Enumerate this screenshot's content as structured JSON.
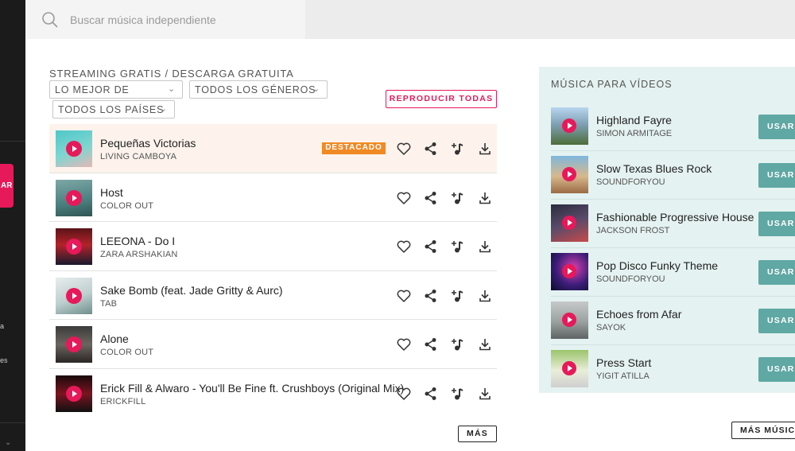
{
  "search": {
    "placeholder": "Buscar música independiente"
  },
  "sidebar": {
    "cta_fragment": "AR",
    "frag1": "a",
    "frag2": "es"
  },
  "main": {
    "heading": "STREAMING GRATIS / DESCARGA GRATUITA",
    "filters": {
      "sort": "LO MEJOR DE",
      "genres": "TODOS LOS GÉNEROS",
      "countries": "TODOS LOS PAÍSES"
    },
    "play_all_label": "REPRODUCIR TODAS",
    "featured_badge": "DESTACADO",
    "more_label": "MÁS",
    "tracks": [
      {
        "title": "Pequeñas Victorias",
        "artist": "LIVING CAMBOYA"
      },
      {
        "title": "Host",
        "artist": "COLOR OUT"
      },
      {
        "title": "LEEONA - Do I",
        "artist": "ZARA ARSHAKIAN"
      },
      {
        "title": "Sake Bomb (feat. Jade Gritty & Aurc)",
        "artist": "TAB"
      },
      {
        "title": "Alone",
        "artist": "COLOR OUT"
      },
      {
        "title": "Erick Fill & Alwaro - You'll Be Fine ft. Crushboys (Original Mix)",
        "artist": "ERICKFILL"
      }
    ]
  },
  "videos": {
    "heading": "MÚSICA PARA VÍDEOS",
    "use_label": "USAR",
    "more_label": "MÁS MÚSIC",
    "items": [
      {
        "title": "Highland Fayre",
        "artist": "SIMON ARMITAGE"
      },
      {
        "title": "Slow Texas Blues Rock",
        "artist": "SOUNDFORYOU"
      },
      {
        "title": "Fashionable Progressive House",
        "artist": "JACKSON FROST"
      },
      {
        "title": "Pop Disco Funky Theme",
        "artist": "SOUNDFORYOU"
      },
      {
        "title": "Echoes from Afar",
        "artist": "SAYOK"
      },
      {
        "title": "Press Start",
        "artist": "YIGIT ATILLA"
      }
    ]
  },
  "colors": {
    "accent": "#e6195a",
    "featured": "#f08a24",
    "teal": "#5fa8a4",
    "panel": "#e4f2f1"
  },
  "icons": [
    "search-icon",
    "heart-icon",
    "share-icon",
    "add-to-playlist-icon",
    "download-icon",
    "play-icon",
    "chevron-down-icon"
  ]
}
